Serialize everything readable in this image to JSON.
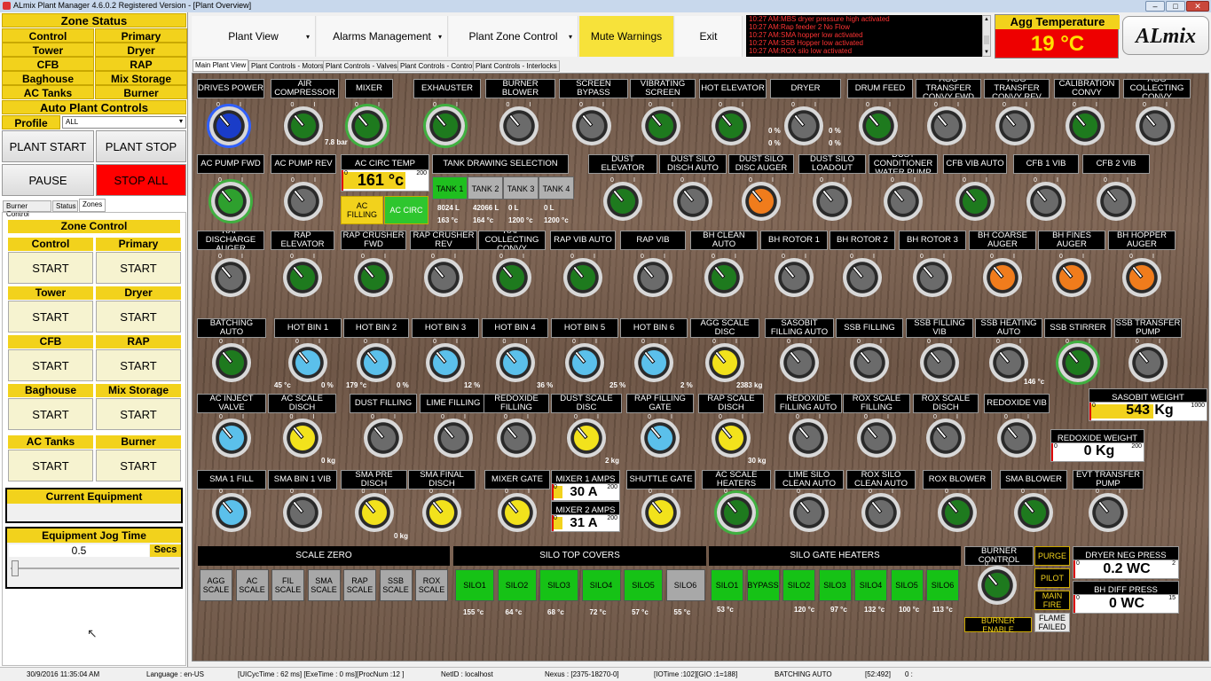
{
  "window": {
    "title": "ALmix Plant Manager 4.6.0.2 Registered Version - [Plant Overview]",
    "min": "–",
    "max": "□",
    "close": "✕"
  },
  "left": {
    "zone_status_title": "Zone Status",
    "zone_status": [
      [
        "Control",
        "Primary"
      ],
      [
        "Tower",
        "Dryer"
      ],
      [
        "CFB",
        "RAP"
      ],
      [
        "Baghouse",
        "Mix Storage"
      ],
      [
        "AC Tanks",
        "Burner"
      ]
    ],
    "auto_title": "Auto Plant Controls",
    "profile_label": "Profile",
    "profile_value": "ALL",
    "plant_start": "PLANT START",
    "plant_stop": "PLANT STOP",
    "pause": "PAUSE",
    "stop_all": "STOP ALL",
    "subtabs": [
      "Burner Control",
      "Status",
      "Zones"
    ],
    "zone_control_title": "Zone Control",
    "start_label": "START",
    "zones": [
      [
        "Control",
        "Primary"
      ],
      [
        "Tower",
        "Dryer"
      ],
      [
        "CFB",
        "RAP"
      ],
      [
        "Baghouse",
        "Mix Storage"
      ],
      [
        "AC Tanks",
        "Burner"
      ]
    ],
    "current_equipment": "Current Equipment",
    "jog_title": "Equipment Jog Time",
    "jog_value": "0.5",
    "jog_unit": "Secs"
  },
  "toolbar": {
    "items": [
      "Plant View",
      "Alarms Management",
      "Plant Zone Control",
      "Mute Warnings",
      "Exit"
    ],
    "caret": "▾"
  },
  "alarms": [
    "10:27 AM:MBS dryer pressure high activated",
    "10:27 AM:Rap feeder 2 No Flow",
    "10:27 AM:SMA hopper low activated",
    "10:27 AM:SSB Hopper low activated",
    "10:27 AM:ROX silo low activated"
  ],
  "agg_temp": {
    "title": "Agg Temperature",
    "value": "19 °C"
  },
  "logo": "ALmix",
  "main_tabs": [
    "Main Plant View",
    "Plant Controls - Motors",
    "Plant Controls - Valves",
    "Plant Controls - Control",
    "Plant Controls - Interlocks"
  ],
  "row1": [
    "DRIVES POWER",
    "AIR COMPRESSOR",
    "MIXER",
    "EXHAUSTER",
    "BURNER BLOWER",
    "SCREEN BYPASS",
    "VIBRATING SCREEN",
    "HOT ELEVATOR",
    "DRYER",
    "DRUM FEED",
    "AGG TRANSFER CONVY FWD",
    "AGG TRANSFER CONVY REV",
    "CALIBRATION CONVY",
    "AGG COLLECTING CONVY"
  ],
  "row1_readouts": {
    "air_comp": "7.8 bar",
    "dryer_a": "0 %",
    "dryer_b": "0 %",
    "dryer_c": "0 %",
    "dryer_d": "0 %"
  },
  "row2": [
    "AC PUMP FWD",
    "AC PUMP REV",
    "DUST ELEVATOR",
    "DUST SILO DISCH AUTO",
    "DUST SILO DISC AUGER",
    "DUST SILO LOADOUT",
    "DUST CONDITIONER WATER PUMP",
    "CFB VIB AUTO",
    "CFB 1 VIB",
    "CFB 2 VIB"
  ],
  "ac_circ": {
    "title": "AC CIRC TEMP",
    "value": "161 °c",
    "min": "0",
    "max": "200",
    "filling": "AC FILLING",
    "circ": "AC CIRC"
  },
  "tanks": {
    "title": "TANK DRAWING SELECTION",
    "names": [
      "TANK 1",
      "TANK 2",
      "TANK 3",
      "TANK 4"
    ],
    "levels": [
      "8024 L",
      "42066 L",
      "0 L",
      "0 L"
    ],
    "temps": [
      "163 °c",
      "164 °c",
      "1200 °c",
      "1200 °c"
    ]
  },
  "row3": [
    "RAP DISCHARGE AUGER",
    "RAP ELEVATOR",
    "RAP CRUSHER FWD",
    "RAP CRUSHER REV",
    "RAP COLLECTING CONVY",
    "RAP VIB AUTO",
    "RAP VIB",
    "BH CLEAN AUTO",
    "BH ROTOR 1",
    "BH ROTOR 2",
    "BH ROTOR 3",
    "BH COARSE AUGER",
    "BH FINES AUGER",
    "BH HOPPER AUGER"
  ],
  "row4": [
    "BATCHING AUTO",
    "HOT BIN 1",
    "HOT BIN 2",
    "HOT BIN 3",
    "HOT BIN 4",
    "HOT BIN 5",
    "HOT BIN 6",
    "AGG SCALE DISC",
    "SASOBIT FILLING AUTO",
    "SSB FILLING",
    "SSB FILLING VIB",
    "SSB HEATING AUTO",
    "SSB STIRRER",
    "SSB TRANSFER PUMP"
  ],
  "row4_readouts": [
    "45 °c",
    "0 %",
    "179 °c",
    "0 %",
    "12 %",
    "36 %",
    "25 %",
    "2 %",
    "2383 kg",
    "146 °c"
  ],
  "sasobit": {
    "title": "SASOBIT WEIGHT",
    "value": "543",
    "unit": "Kg",
    "min": "0",
    "max": "1000"
  },
  "row5": [
    "AC INJECT VALVE",
    "AC SCALE DISCH",
    "DUST FILLING",
    "LIME FILLING",
    "REDOXIDE FILLING",
    "DUST SCALE DISC",
    "RAP FILLING GATE",
    "RAP SCALE DISCH",
    "REDOXIDE FILLING AUTO",
    "ROX SCALE FILLING",
    "ROX SCALE DISCH",
    "REDOXIDE VIB"
  ],
  "row5_readouts": [
    "0 kg",
    "2 kg",
    "30 kg"
  ],
  "redoxide": {
    "title": "REDOXIDE WEIGHT",
    "value": "0 Kg",
    "min": "0",
    "max": "200"
  },
  "row6": [
    "SMA 1 FILL",
    "SMA BIN 1 VIB",
    "SMA PRE DISCH",
    "SMA FINAL DISCH",
    "MIXER GATE",
    "SHUTTLE GATE",
    "AC SCALE HEATERS",
    "LIME SILO CLEAN AUTO",
    "ROX SILO CLEAN AUTO",
    "ROX BLOWER",
    "SMA BLOWER",
    "EVT TRANSFER PUMP"
  ],
  "row6_readouts": [
    "0 kg"
  ],
  "mixer_amps": [
    {
      "title": "MIXER 1 AMPS",
      "value": "30 A",
      "min": "0",
      "max": "200"
    },
    {
      "title": "MIXER 2 AMPS",
      "value": "31 A",
      "min": "0",
      "max": "200"
    }
  ],
  "scale_zero": {
    "title": "SCALE ZERO",
    "buttons": [
      "AGG SCALE",
      "AC SCALE",
      "FIL SCALE",
      "SMA SCALE",
      "RAP SCALE",
      "SSB SCALE",
      "ROX SCALE"
    ]
  },
  "silo_covers": {
    "title": "SILO TOP COVERS",
    "buttons": [
      "SILO1",
      "SILO2",
      "SILO3",
      "SILO4",
      "SILO5",
      "SILO6"
    ],
    "temps": [
      "155 °c",
      "64 °c",
      "68 °c",
      "72 °c",
      "57 °c",
      "55 °c"
    ]
  },
  "silo_heaters": {
    "title": "SILO GATE HEATERS",
    "buttons": [
      "SILO1",
      "BYPASS",
      "SILO2",
      "SILO3",
      "SILO4",
      "SILO5",
      "SILO6"
    ],
    "temps": [
      "53 °c",
      "120 °c",
      "97 °c",
      "132 °c",
      "100 °c",
      "113 °c"
    ]
  },
  "burner": {
    "title": "BURNER CONTROL",
    "enable": "BURNER ENABLE",
    "purge": "PURGE",
    "pilot": "PILOT",
    "main_fire": "MAIN FIRE",
    "flame_failed": "FLAME FAILED"
  },
  "dryer_neg": {
    "title": "DRYER NEG PRESS",
    "value": "0.2 WC",
    "min": "0",
    "max": "2"
  },
  "bh_diff": {
    "title": "BH DIFF PRESS",
    "value": "0 WC",
    "min": "0",
    "max": "15"
  },
  "statusbar": [
    "30/9/2016 11:35:04 AM",
    "Language : en-US",
    "[UICycTime : 62 ms] [ExeTime : 0 ms][ProcNum :12 ]",
    "NetID : localhost",
    "Nexus : [2375-18270-0]",
    "[IOTime :102][GIO :1=188]",
    "BATCHING AUTO",
    "[52:492]",
    "0 :"
  ],
  "colors": {
    "yellow": "#f2d21c",
    "green_knob": "#1e7a1e",
    "grey_knob": "#6b6b6b",
    "blue_knob": "#5bc0eb",
    "yellow_knob": "#f2e21c",
    "orange_knob": "#f07c1c",
    "stop_red": "#ff0000"
  }
}
